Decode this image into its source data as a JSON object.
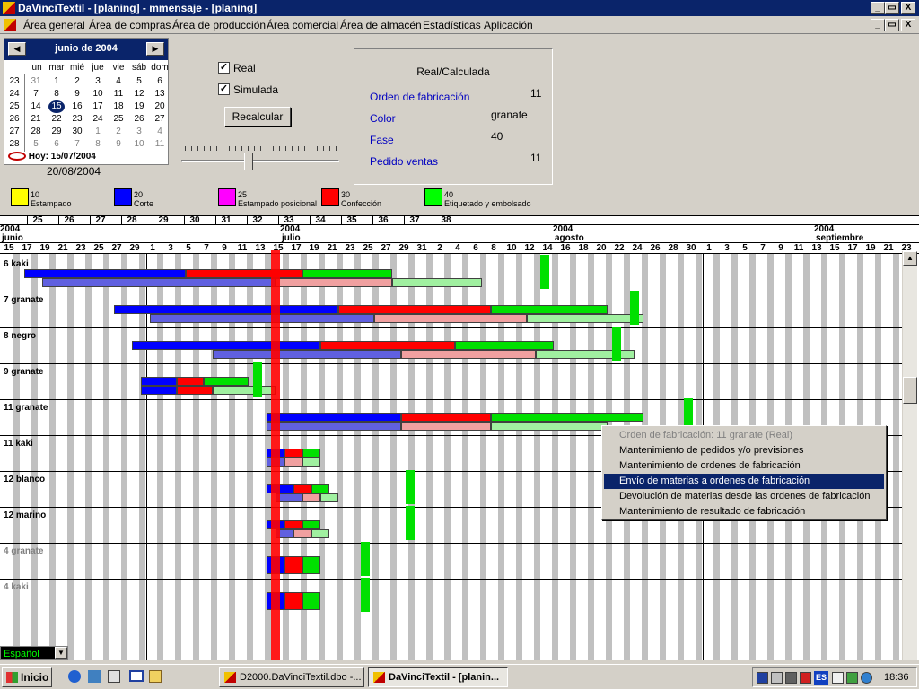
{
  "window": {
    "title": "DaVinciTextil - [planing]  -  mmensaje - [planing]",
    "controls": [
      "_",
      "▭",
      "X"
    ]
  },
  "menu": {
    "items": [
      "Área general",
      "Área de compras",
      "Área de producción",
      "Área comercial",
      "Área de almacén",
      "Estadísticas",
      "Aplicación"
    ]
  },
  "calendar": {
    "month": "junio de 2004",
    "prev": "◀",
    "next": "▶",
    "weekdays": [
      "lun",
      "mar",
      "mié",
      "jue",
      "vie",
      "sáb",
      "dom"
    ],
    "weeks": [
      {
        "wk": "23",
        "days": [
          "31",
          "1",
          "2",
          "3",
          "4",
          "5",
          "6"
        ]
      },
      {
        "wk": "24",
        "days": [
          "7",
          "8",
          "9",
          "10",
          "11",
          "12",
          "13"
        ]
      },
      {
        "wk": "25",
        "days": [
          "14",
          "15",
          "16",
          "17",
          "18",
          "19",
          "20"
        ]
      },
      {
        "wk": "26",
        "days": [
          "21",
          "22",
          "23",
          "24",
          "25",
          "26",
          "27"
        ]
      },
      {
        "wk": "27",
        "days": [
          "28",
          "29",
          "30",
          "1",
          "2",
          "3",
          "4"
        ]
      },
      {
        "wk": "28",
        "days": [
          "5",
          "6",
          "7",
          "8",
          "9",
          "10",
          "11"
        ]
      }
    ],
    "selected_day": "15",
    "today_label": "Hoy: 15/07/2004",
    "extra_date": "20/08/2004"
  },
  "options": {
    "real_label": "Real",
    "real_checked": true,
    "simulada_label": "Simulada",
    "simulada_checked": true,
    "recalc_button": "Recalcular",
    "slider_position": 0.42
  },
  "info": {
    "header": "Real/Calculada",
    "rows": [
      {
        "label": "Orden de fabricación",
        "value": "11"
      },
      {
        "label": "Color",
        "value": "granate"
      },
      {
        "label": "Fase",
        "value": "40"
      },
      {
        "label": "Pedido ventas",
        "value": "11"
      }
    ]
  },
  "legend": [
    {
      "code": "10",
      "name": "Estampado",
      "color": "#ffff00"
    },
    {
      "code": "20",
      "name": "Corte",
      "color": "#0000ff"
    },
    {
      "code": "25",
      "name": "Estampado posicional",
      "color": "#ff00ff"
    },
    {
      "code": "30",
      "name": "Confección",
      "color": "#ff0000"
    },
    {
      "code": "40",
      "name": "Etiquetado y embolsado",
      "color": "#00ff00"
    }
  ],
  "timeline": {
    "weeks": [
      "25",
      "26",
      "27",
      "28",
      "29",
      "30",
      "31",
      "32",
      "33",
      "34",
      "35",
      "36",
      "37",
      "38"
    ],
    "years": [
      "2004",
      "2004",
      "2004",
      "2004"
    ],
    "months": [
      "junio",
      "julio",
      "agosto",
      "septiembre"
    ],
    "days": [
      "15",
      "17",
      "19",
      "21",
      "23",
      "25",
      "27",
      "29",
      "1",
      "3",
      "5",
      "7",
      "9",
      "11",
      "13",
      "15",
      "17",
      "19",
      "21",
      "23",
      "25",
      "27",
      "29",
      "31",
      "2",
      "4",
      "6",
      "8",
      "10",
      "12",
      "14",
      "16",
      "18",
      "20",
      "22",
      "24",
      "26",
      "28",
      "30",
      "1",
      "3",
      "5",
      "7",
      "9",
      "11",
      "13",
      "15",
      "17",
      "19",
      "21",
      "23"
    ]
  },
  "rows": [
    {
      "label": "6 kaki",
      "muted": false
    },
    {
      "label": "7 granate",
      "muted": false
    },
    {
      "label": "8 negro",
      "muted": false
    },
    {
      "label": "9 granate",
      "muted": false
    },
    {
      "label": "11 granate",
      "muted": false
    },
    {
      "label": "11 kaki",
      "muted": false
    },
    {
      "label": "12 blanco",
      "muted": false
    },
    {
      "label": "12 marino",
      "muted": false
    },
    {
      "label": "4 granate",
      "muted": true
    },
    {
      "label": "4 kaki",
      "muted": true
    }
  ],
  "context_menu": {
    "items": [
      {
        "label": "Orden de fabricación: 11 granate    (Real)",
        "state": "disabled"
      },
      {
        "label": "Mantenimiento de pedidos y/o previsiones",
        "state": "normal"
      },
      {
        "label": "Mantenimiento de ordenes de fabricación",
        "state": "normal"
      },
      {
        "label": "Envío de materias a ordenes de fabricación",
        "state": "selected"
      },
      {
        "label": "Devolución de materias desde las ordenes de fabricación",
        "state": "normal"
      },
      {
        "label": "Mantenimiento de resultado de fabricación",
        "state": "normal"
      }
    ]
  },
  "language": "Español",
  "taskbar": {
    "start": "Inicio",
    "tasks": [
      "D2000.DaVinciTextil.dbo -...",
      "DaVinciTextil - [planin..."
    ],
    "tray_lang": "ES",
    "clock": "18:36"
  }
}
